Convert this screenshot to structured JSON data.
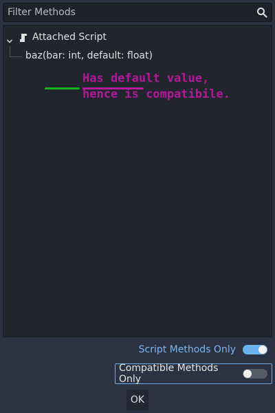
{
  "filter": {
    "placeholder": "Filter Methods",
    "icon": "search-icon"
  },
  "tree": {
    "root": {
      "label": "Attached Script",
      "icon": "script-icon",
      "expanded": true
    },
    "method": {
      "name": "baz(",
      "param1": "bar: int",
      "sep": ", ",
      "param2": "default: float",
      "close": ")"
    }
  },
  "annotation": {
    "line1": "Has default value,",
    "line2": "hence is compatibile.",
    "color": "#b3189a",
    "underline_colors": [
      "#17b517",
      "#b51a9c"
    ]
  },
  "options": {
    "script_methods_only": {
      "label": "Script Methods Only",
      "checked": true
    },
    "compatible_methods_only": {
      "label": "Compatible Methods Only",
      "checked": false
    }
  },
  "buttons": {
    "ok": "OK"
  },
  "colors": {
    "background": "#2b3242",
    "panel": "#21252e",
    "accent": "#6ab3f0"
  }
}
